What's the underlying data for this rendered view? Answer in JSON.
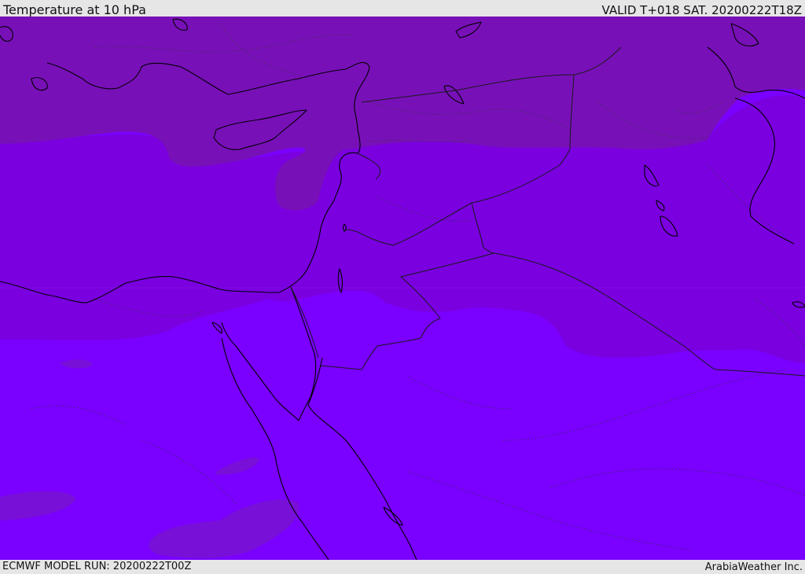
{
  "header": {
    "title": "Temperature at 10 hPa",
    "valid_time": "VALID T+018 SAT. 20200222T18Z"
  },
  "footer": {
    "model_run": "ECMWF MODEL RUN: 20200222T00Z",
    "credit": "ArabiaWeather Inc."
  },
  "map": {
    "field": "Temperature at 10 hPa",
    "colors": {
      "band_cold": "#7810b8",
      "band_mid": "#7a00e0",
      "band_warm": "#7a00ff",
      "coastline": "#000000",
      "border": "#1a1a1a"
    }
  }
}
